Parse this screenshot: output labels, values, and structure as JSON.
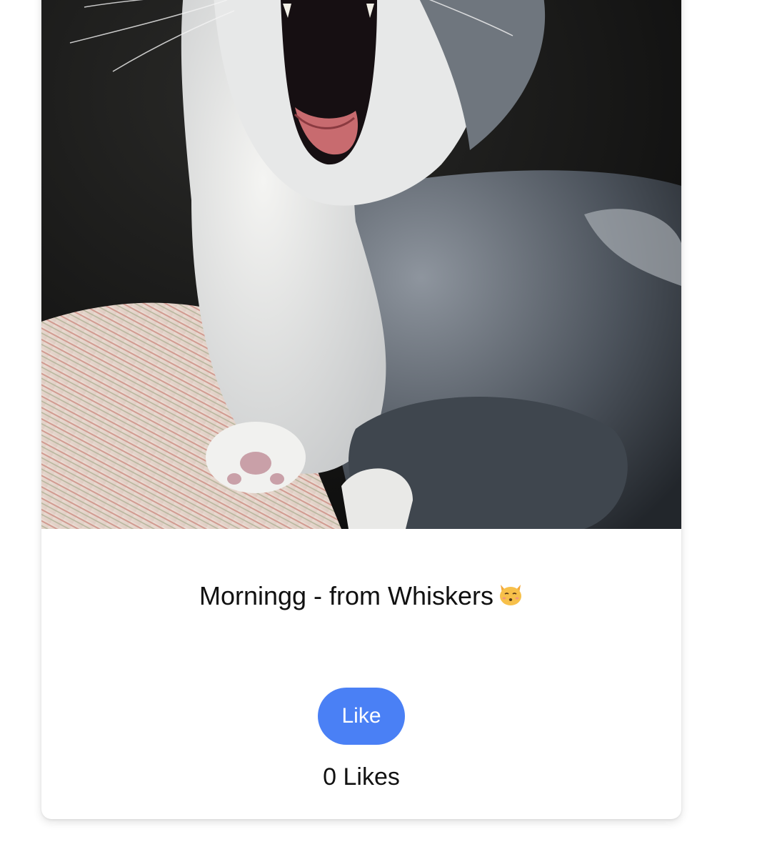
{
  "post": {
    "image_alt": "cat-yawning-photo",
    "caption": "Morningg - from Whiskers",
    "caption_emoji_icon": "kissing-cat-face-icon",
    "like_button_label": "Like",
    "likes_count": "0",
    "likes_label": "Likes"
  },
  "colors": {
    "button_bg": "#4a80f5",
    "button_text": "#ffffff",
    "text": "#111111"
  }
}
